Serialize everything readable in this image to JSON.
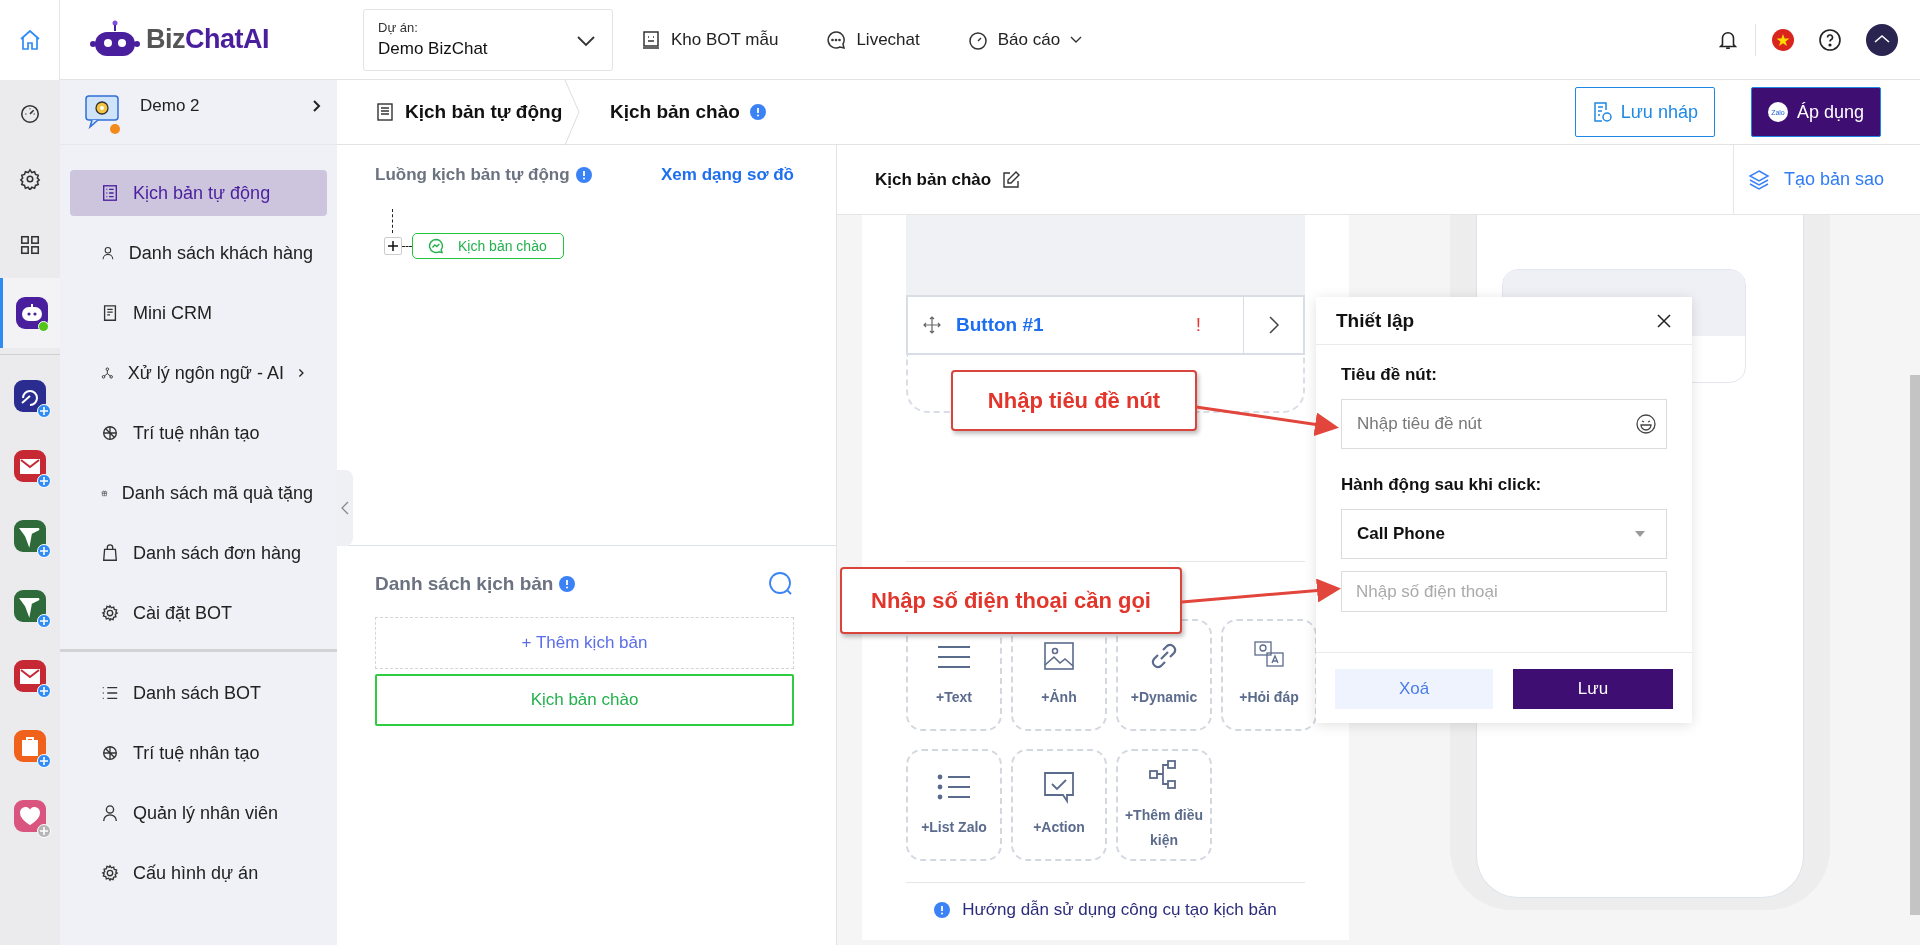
{
  "header": {
    "logo": {
      "part1": "Biz",
      "part2": "ChatAI"
    },
    "project": {
      "label": "Dự án:",
      "value": "Demo BizChat"
    },
    "nav": [
      {
        "label": "Kho BOT mẫu",
        "kind": "bot",
        "dropdown": false
      },
      {
        "label": "Livechat",
        "kind": "chat",
        "dropdown": false
      },
      {
        "label": "Báo cáo",
        "kind": "gauge",
        "dropdown": true
      }
    ]
  },
  "rail": {
    "home": {
      "selected": false
    },
    "tools": [
      {
        "kind": "gauge",
        "selected": false
      },
      {
        "kind": "gear",
        "selected": false
      },
      {
        "kind": "grid",
        "selected": false
      }
    ],
    "apps": [
      {
        "kind": "bot",
        "color": "#4a1f9e",
        "selected": true,
        "badge": false
      },
      {
        "kind": "swirl",
        "color": "#2a2d8f",
        "selected": false,
        "badge": true,
        "badge_active": true
      },
      {
        "kind": "mail",
        "color": "#c62834",
        "selected": false,
        "badge": true,
        "badge_active": true
      },
      {
        "kind": "plane",
        "color": "#2f6b3a",
        "selected": false,
        "badge": true,
        "badge_active": true
      },
      {
        "kind": "plane",
        "color": "#2f6b3a",
        "selected": false,
        "badge": true,
        "badge_active": true
      },
      {
        "kind": "mail",
        "color": "#c62834",
        "selected": false,
        "badge": true,
        "badge_active": true
      },
      {
        "kind": "bag",
        "color": "#f0621c",
        "selected": false,
        "badge": true,
        "badge_active": true
      },
      {
        "kind": "heart",
        "color": "#d9557f",
        "selected": false,
        "badge": true,
        "badge_active": false
      }
    ]
  },
  "sidebar": {
    "project": {
      "name": "Demo 2"
    },
    "items": [
      {
        "label": "Kịch bản tự động",
        "kind": "script",
        "selected": true,
        "submenu": false
      },
      {
        "label": "Danh sách khách hàng",
        "kind": "user",
        "selected": false,
        "submenu": false
      },
      {
        "label": "Mini CRM",
        "kind": "doc",
        "selected": false,
        "submenu": false
      },
      {
        "label": "Xử lý ngôn ngữ - AI",
        "kind": "nodes",
        "selected": false,
        "submenu": true
      },
      {
        "label": "Trí tuệ nhân tạo",
        "kind": "ai",
        "selected": false,
        "submenu": false
      },
      {
        "label": "Danh sách mã quà tặng",
        "kind": "gift",
        "selected": false,
        "submenu": false
      },
      {
        "label": "Danh sách đơn hàng",
        "kind": "bag",
        "selected": false,
        "submenu": false
      },
      {
        "label": "Cài đặt BOT",
        "kind": "gear",
        "selected": false,
        "submenu": false
      }
    ],
    "bottom_items": [
      {
        "label": "Danh sách BOT",
        "kind": "list",
        "selected": false
      },
      {
        "label": "Trí tuệ nhân tạo",
        "kind": "ai",
        "selected": false
      },
      {
        "label": "Quản lý nhân viên",
        "kind": "user",
        "selected": false
      },
      {
        "label": "Cấu hình dự án",
        "kind": "gear",
        "selected": false
      }
    ]
  },
  "breadcrumb": [
    {
      "label": "Kịch bản tự động",
      "info": false
    },
    {
      "label": "Kịch bản chào",
      "info": true
    }
  ],
  "actions": [
    {
      "label": "Lưu nháp",
      "kind": "outline"
    },
    {
      "label": "Áp dụng",
      "kind": "primary",
      "badge": "Zalo"
    }
  ],
  "flow": {
    "title": "Luồng kịch bản tự động",
    "link": "Xem dạng sơ đồ",
    "nodes": [
      {
        "label": "Kịch bản chào"
      }
    ]
  },
  "script_list": {
    "title": "Danh sách kịch bản",
    "add_label": "+ Thêm kịch bản",
    "items": [
      {
        "label": "Kịch bản chào",
        "selected": true
      }
    ]
  },
  "editor": {
    "title": "Kịch bản chào",
    "copy_label": "Tạo bản sao",
    "button_row": {
      "label": "Button #1",
      "warning": "!"
    },
    "tools": [
      {
        "label": "+Text",
        "kind": "text"
      },
      {
        "label": "+Ảnh",
        "kind": "image"
      },
      {
        "label": "+Dynamic",
        "kind": "link"
      },
      {
        "label": "+Hỏi đáp",
        "kind": "qa"
      },
      {
        "label": "+List Zalo",
        "kind": "list"
      },
      {
        "label": "+Action",
        "kind": "action"
      },
      {
        "label": "+Thêm điều kiện",
        "kind": "flow"
      }
    ],
    "help": "Hướng dẫn sử dụng công cụ tạo kịch bản"
  },
  "popup": {
    "title": "Thiết lập",
    "title_label": "Tiêu đề nút:",
    "title_placeholder": "Nhập tiêu đề nút",
    "action_label": "Hành động sau khi click:",
    "action_value": "Call Phone",
    "phone_placeholder": "Nhập số điện thoại",
    "buttons": [
      {
        "label": "Xoá",
        "kind": "secondary"
      },
      {
        "label": "Lưu",
        "kind": "primary"
      }
    ]
  },
  "callouts": [
    {
      "text": "Nhập tiêu đề nút"
    },
    {
      "text": "Nhập số điện thoại cần gọi"
    }
  ]
}
